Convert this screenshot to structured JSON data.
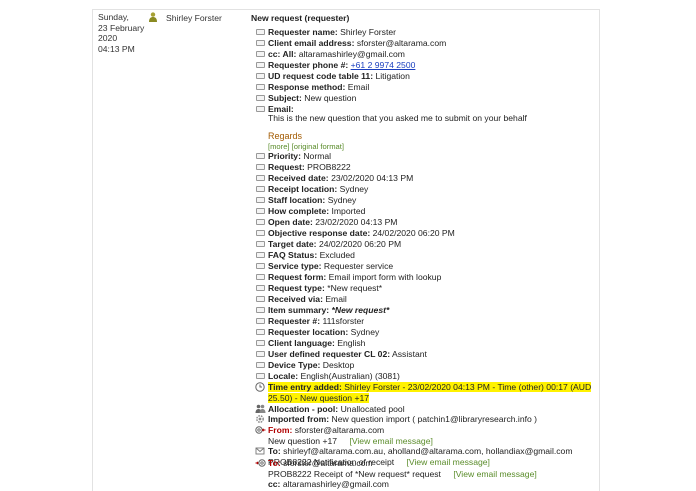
{
  "entry": {
    "date_line1": "Sunday,",
    "date_line2": "23 February",
    "date_line3": "2020",
    "time": "04:13 PM",
    "user": "Shirley Forster",
    "title": "New request (requester)"
  },
  "fields": {
    "requester_name_label": "Requester name:",
    "requester_name": "Shirley Forster",
    "client_email_label": "Client email address:",
    "client_email": "sforster@altarama.com",
    "cc_all_label": "cc: All:",
    "cc_all": "altaramashirley@gmail.com",
    "requester_phone_label": "Requester phone #:",
    "requester_phone": "+61 2 9974 2500",
    "ud_code_label": "UD request code table 11:",
    "ud_code": "Litigation",
    "response_method_label": "Response method:",
    "response_method": "Email",
    "subject_label": "Subject:",
    "subject": "New question",
    "email_label": "Email:",
    "email_body": "This is the new question that you asked me to submit on your behalf",
    "regards": "Regards",
    "more_link": "[more]",
    "original_format_link": "[original format]",
    "priority_label": "Priority:",
    "priority": "Normal",
    "request_label": "Request:",
    "request": "PROB8222",
    "received_date_label": "Received date:",
    "received_date": "23/02/2020 04:13 PM",
    "receipt_location_label": "Receipt location:",
    "receipt_location": "Sydney",
    "staff_location_label": "Staff location:",
    "staff_location": "Sydney",
    "how_complete_label": "How complete:",
    "how_complete": "Imported",
    "open_date_label": "Open date:",
    "open_date": "23/02/2020 04:13 PM",
    "objective_date_label": "Objective response date:",
    "objective_date": "24/02/2020 06:20 PM",
    "target_date_label": "Target date:",
    "target_date": "24/02/2020 06:20 PM",
    "faq_label": "FAQ Status:",
    "faq": "Excluded",
    "service_type_label": "Service type:",
    "service_type": "Requester service",
    "request_form_label": "Request form:",
    "request_form": "Email import form with lookup",
    "request_type_label": "Request type:",
    "request_type": "*New request*",
    "received_via_label": "Received via:",
    "received_via": "Email",
    "item_summary_label": "Item summary:",
    "item_summary": "*New request*",
    "requester_num_label": "Requester #:",
    "requester_num": "111sforster",
    "requester_location_label": "Requester location:",
    "requester_location": "Sydney",
    "client_language_label": "Client language:",
    "client_language": "English",
    "udr_cl02_label": "User defined requester CL 02:",
    "udr_cl02": "Assistant",
    "device_type_label": "Device Type:",
    "device_type": "Desktop",
    "locale_label": "Locale:",
    "locale": "English(Australian) (3081)"
  },
  "time_entry": {
    "label": "Time entry added:",
    "line1": "Shirley Forster  -  23/02/2020 04:13 PM  -  Time (other)  00:17  (AUD",
    "line2": "25.50)  -  New question +17"
  },
  "allocation": {
    "label": "Allocation - pool:",
    "value": "Unallocated pool"
  },
  "imported": {
    "label": "Imported from:",
    "value": "New question import ( patchin1@libraryresearch.info )"
  },
  "email_from": {
    "label": "From:",
    "address": "sforster@altarama.com",
    "subject": "New question +17",
    "view_link": "[View email message]"
  },
  "email_to1": {
    "label": "To:",
    "address": "shirleyf@altarama.com.au, aholland@altarama.com, hollandiax@gmail.com",
    "subject": "PROB8222 Notification of receipt",
    "view_link": "[View email message]"
  },
  "email_to2": {
    "label": "To:",
    "address": "sforster@altarama.com",
    "subject": "PROB8222 Receipt of *New request* request",
    "view_link": "[View email message]",
    "cc_label": "cc:",
    "cc": "altaramashirley@gmail.com"
  },
  "icons": {
    "field": "field-marker-icon",
    "clock": "clock-icon",
    "pool": "people-icon",
    "import": "gear-icon",
    "email_in": "email-at-in-icon",
    "email_out": "envelope-icon",
    "email_red": "email-at-out-icon",
    "user": "user-icon"
  },
  "colors": {
    "highlight": "#fff200",
    "link": "#1a3fbf",
    "green_link": "#5a8c2a",
    "regards": "#a25a00",
    "red": "#b00000"
  }
}
